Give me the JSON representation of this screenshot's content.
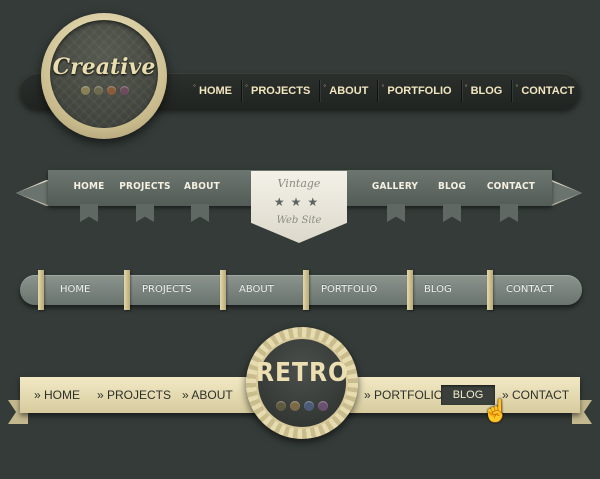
{
  "nav1": {
    "badge_title": "Creative",
    "badge_dots": [
      "#8a7f55",
      "#6d6a4c",
      "#8a5b3a",
      "#6d4b5c"
    ],
    "items": [
      "HOME",
      "PROJECTS",
      "ABOUT",
      "PORTFOLIO",
      "BLOG",
      "CONTACT"
    ]
  },
  "nav2": {
    "items": [
      "HOME",
      "PROJECTS",
      "ABOUT",
      "GALLERY",
      "BLOG",
      "CONTACT"
    ],
    "badge_line1": "Vintage",
    "badge_stars": "★★★",
    "badge_line2": "Web Site"
  },
  "nav3": {
    "items": [
      "HOME",
      "PROJECTS",
      "ABOUT",
      "PORTFOLIO",
      "BLOG",
      "CONTACT"
    ]
  },
  "nav4": {
    "items": [
      "» HOME",
      "» PROJECTS",
      "» ABOUT",
      "» PORTFOLIO",
      "BLOG",
      "» CONTACT"
    ],
    "active_item": "BLOG",
    "badge_title": "RETRO",
    "badge_dots": [
      "#5e5a40",
      "#7a6a46",
      "#4c5a78",
      "#6a5070"
    ],
    "cursor": "hand-pointer-icon"
  }
}
